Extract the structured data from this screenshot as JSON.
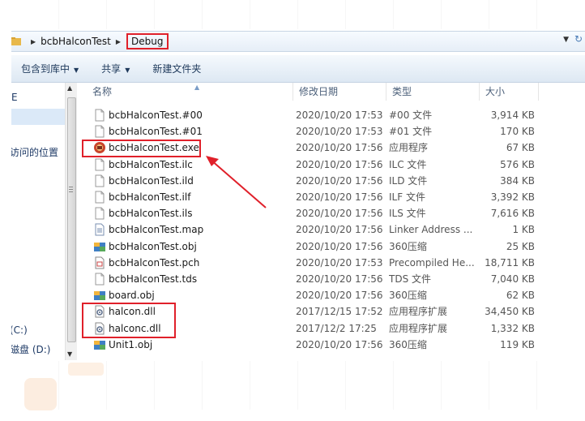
{
  "breadcrumb": {
    "items": [
      "bcbHalconTest",
      "Debug"
    ]
  },
  "toolbar": {
    "library": "包含到库中",
    "share": "共享",
    "new_folder": "新建文件夹"
  },
  "nav": {
    "items": [
      "E",
      "访问的位置",
      "(C:)",
      "磁盘 (D:)"
    ]
  },
  "columns": {
    "name": "名称",
    "date": "修改日期",
    "type": "类型",
    "size": "大小"
  },
  "files": [
    {
      "name": "bcbHalconTest.#00",
      "date": "2020/10/20 17:53",
      "type": "#00 文件",
      "size": "3,914 KB",
      "icon": "generic-file-icon"
    },
    {
      "name": "bcbHalconTest.#01",
      "date": "2020/10/20 17:53",
      "type": "#01 文件",
      "size": "170 KB",
      "icon": "generic-file-icon"
    },
    {
      "name": "bcbHalconTest.exe",
      "date": "2020/10/20 17:56",
      "type": "应用程序",
      "size": "67 KB",
      "icon": "application-icon"
    },
    {
      "name": "bcbHalconTest.ilc",
      "date": "2020/10/20 17:56",
      "type": "ILC 文件",
      "size": "576 KB",
      "icon": "generic-file-icon"
    },
    {
      "name": "bcbHalconTest.ild",
      "date": "2020/10/20 17:56",
      "type": "ILD 文件",
      "size": "384 KB",
      "icon": "generic-file-icon"
    },
    {
      "name": "bcbHalconTest.ilf",
      "date": "2020/10/20 17:56",
      "type": "ILF 文件",
      "size": "3,392 KB",
      "icon": "generic-file-icon"
    },
    {
      "name": "bcbHalconTest.ils",
      "date": "2020/10/20 17:56",
      "type": "ILS 文件",
      "size": "7,616 KB",
      "icon": "generic-file-icon"
    },
    {
      "name": "bcbHalconTest.map",
      "date": "2020/10/20 17:56",
      "type": "Linker Address ...",
      "size": "1 KB",
      "icon": "map-file-icon"
    },
    {
      "name": "bcbHalconTest.obj",
      "date": "2020/10/20 17:56",
      "type": "360压缩",
      "size": "25 KB",
      "icon": "archive-icon"
    },
    {
      "name": "bcbHalconTest.pch",
      "date": "2020/10/20 17:53",
      "type": "Precompiled He...",
      "size": "18,711 KB",
      "icon": "header-file-icon"
    },
    {
      "name": "bcbHalconTest.tds",
      "date": "2020/10/20 17:56",
      "type": "TDS 文件",
      "size": "7,040 KB",
      "icon": "generic-file-icon"
    },
    {
      "name": "board.obj",
      "date": "2020/10/20 17:56",
      "type": "360压缩",
      "size": "62 KB",
      "icon": "archive-icon"
    },
    {
      "name": "halcon.dll",
      "date": "2017/12/15 17:52",
      "type": "应用程序扩展",
      "size": "34,450 KB",
      "icon": "dll-icon"
    },
    {
      "name": "halconc.dll",
      "date": "2017/12/2 17:25",
      "type": "应用程序扩展",
      "size": "1,332 KB",
      "icon": "dll-icon"
    },
    {
      "name": "Unit1.obj",
      "date": "2020/10/20 17:56",
      "type": "360压缩",
      "size": "119 KB",
      "icon": "archive-icon"
    }
  ],
  "colors": {
    "highlight": "#e0202a",
    "link_text": "#1e395b"
  }
}
